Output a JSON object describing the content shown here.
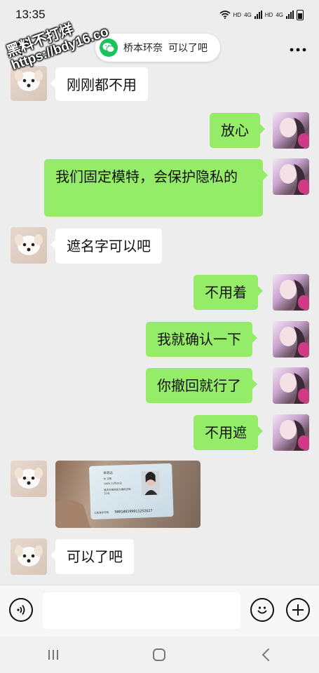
{
  "status": {
    "time": "13:35",
    "net1": "HD",
    "net1b": "4G",
    "net2": "HD",
    "net2b": "4G"
  },
  "header": {
    "contact": "桥本环奈",
    "status_text": "可以了吧"
  },
  "watermark": {
    "line1": "黑料不打烊",
    "line2": "https://bdy16.co"
  },
  "messages": [
    {
      "side": "left",
      "text": "刚刚都不用"
    },
    {
      "side": "right",
      "text": "放心"
    },
    {
      "side": "right",
      "text": "我们固定模特，会保护隐私的"
    },
    {
      "side": "left",
      "text": "遮名字可以吧"
    },
    {
      "side": "right",
      "text": "不用着"
    },
    {
      "side": "right",
      "text": "我就确认一下"
    },
    {
      "side": "right",
      "text": "你撤回就行了"
    },
    {
      "side": "right",
      "text": "不用遮"
    },
    {
      "side": "left",
      "type": "image"
    },
    {
      "side": "left",
      "text": "可以了吧"
    }
  ],
  "id_card": {
    "name": "李思远",
    "line1": "女  汉族",
    "line2": "1999  11月20日",
    "address1": "重庆市南岸区大佛段正街",
    "address2": "21号",
    "id_label": "公民身份号码",
    "id_number": "500108199911252627"
  },
  "input": {
    "placeholder": "",
    "value": ""
  },
  "icons": {
    "back": "back-arrow-icon",
    "more": "more-dots-icon",
    "voice": "voice-icon",
    "emoji": "emoji-icon",
    "plus": "plus-icon"
  },
  "colors": {
    "sent_bubble": "#95ec69",
    "received_bubble": "#ffffff",
    "background": "#ededed",
    "wechat_green": "#19c35c"
  }
}
